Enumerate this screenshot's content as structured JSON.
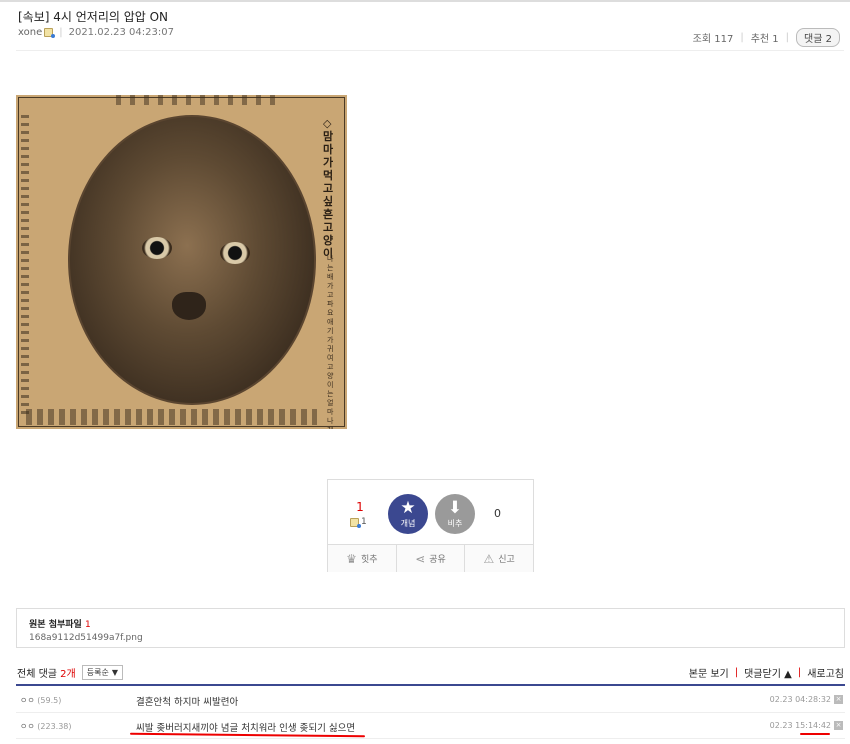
{
  "post": {
    "title": "[속보] 4시 언저리의 압압 ON",
    "author": "xone",
    "datetime": "2021.02.23 04:23:07",
    "views_label": "조회 117",
    "recommend_label": "추천 1",
    "reply_label": "댓글 2"
  },
  "image": {
    "vertical_headline": "◇맘마가먹고싶흔고양이",
    "vertical_sub": "나는배가고파요애기가귀여고양이는얼마나게지!"
  },
  "vote": {
    "up_count": "1",
    "fixed_count": "1",
    "up_label": "개념",
    "down_label": "비추",
    "down_count": "0",
    "actions": [
      {
        "icon": "crown-icon",
        "label": "힛추"
      },
      {
        "icon": "share-icon",
        "label": "공유"
      },
      {
        "icon": "siren-icon",
        "label": "신고"
      }
    ]
  },
  "attachment": {
    "title": "원본 첨부파일",
    "count": "1",
    "filename": "168a9112d51499a7f.png"
  },
  "comments_header": {
    "total_label": "전체 댓글",
    "count": "2개",
    "sort_label": "등록순",
    "view_post": "본문 보기",
    "fold": "댓글닫기",
    "refresh": "새로고침"
  },
  "comments": [
    {
      "nick": "ㅇㅇ",
      "ip": "(59.5)",
      "text": "결혼안척 하지마 씨발련아",
      "time": "02.23 04:28:32"
    },
    {
      "nick": "ㅇㅇ",
      "ip": "(223.38)",
      "text": "씨발 좆버러지새끼야 념글 처치워라 인생 좆되기 싫으면",
      "time": "02.23 15:14:42"
    }
  ],
  "colors": {
    "accent": "#3b4890",
    "highlight": "#dd0000",
    "annotation": "#ee0000"
  }
}
